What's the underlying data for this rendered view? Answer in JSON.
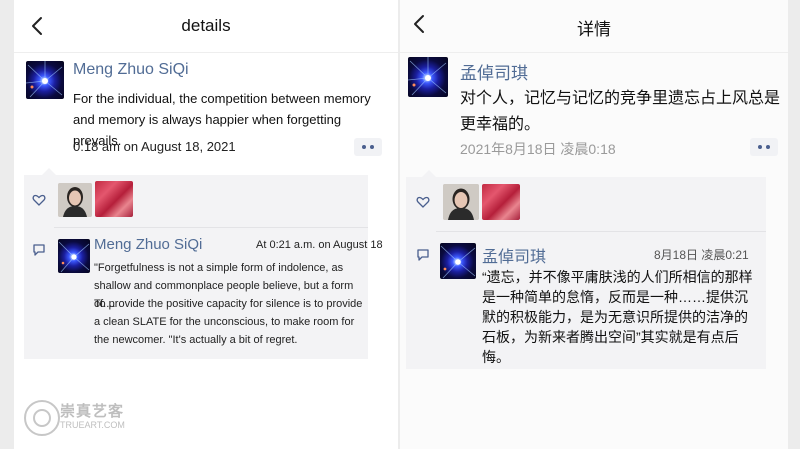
{
  "left_panel": {
    "nav_title": "details",
    "post": {
      "author": "Meng Zhuo SiQi",
      "text": "For the individual, the competition between memory and memory is always happier when forgetting prevails.",
      "time": "0:18 am on August 18, 2021"
    },
    "comment": {
      "author": "Meng Zhuo SiQi",
      "time": "At 0:21 a.m. on August 18",
      "text_1": "\"Forgetfulness is not a simple form of indolence, as shallow and commonplace people believe, but a form of....",
      "text_2": "To provide the positive capacity for silence is to provide a clean SLATE for the unconscious, to make room for the newcomer. \"It's actually a bit of regret."
    }
  },
  "right_panel": {
    "nav_title": "详情",
    "post": {
      "author": "孟倬司琪",
      "text": "对个人，记忆与记忆的竞争里遗忘占上风总是更幸福的。",
      "time": "2021年8月18日 凌晨0:18"
    },
    "comment": {
      "author": "孟倬司琪",
      "time": "8月18日 凌晨0:21",
      "text": "“遗忘，并不像平庸肤浅的人们所相信的那样是一种简单的怠惰，反而是一种……提供沉默的积极能力，是为无意识所提供的洁净的石板，为新来者腾出空间”其实就是有点后悔。"
    }
  },
  "watermark": {
    "cn": "崇真艺客",
    "en": "TRUEART.COM"
  },
  "colors": {
    "name_link": "#516c95",
    "panel_bg": "#ffffff",
    "comment_box_bg": "#f3f3f5",
    "outer_bg": "#ececec"
  },
  "icons": [
    "back-chevron-icon",
    "more-dots-icon",
    "heart-icon",
    "comment-icon",
    "blue-light-avatar",
    "portrait-avatar",
    "red-pattern-avatar"
  ]
}
